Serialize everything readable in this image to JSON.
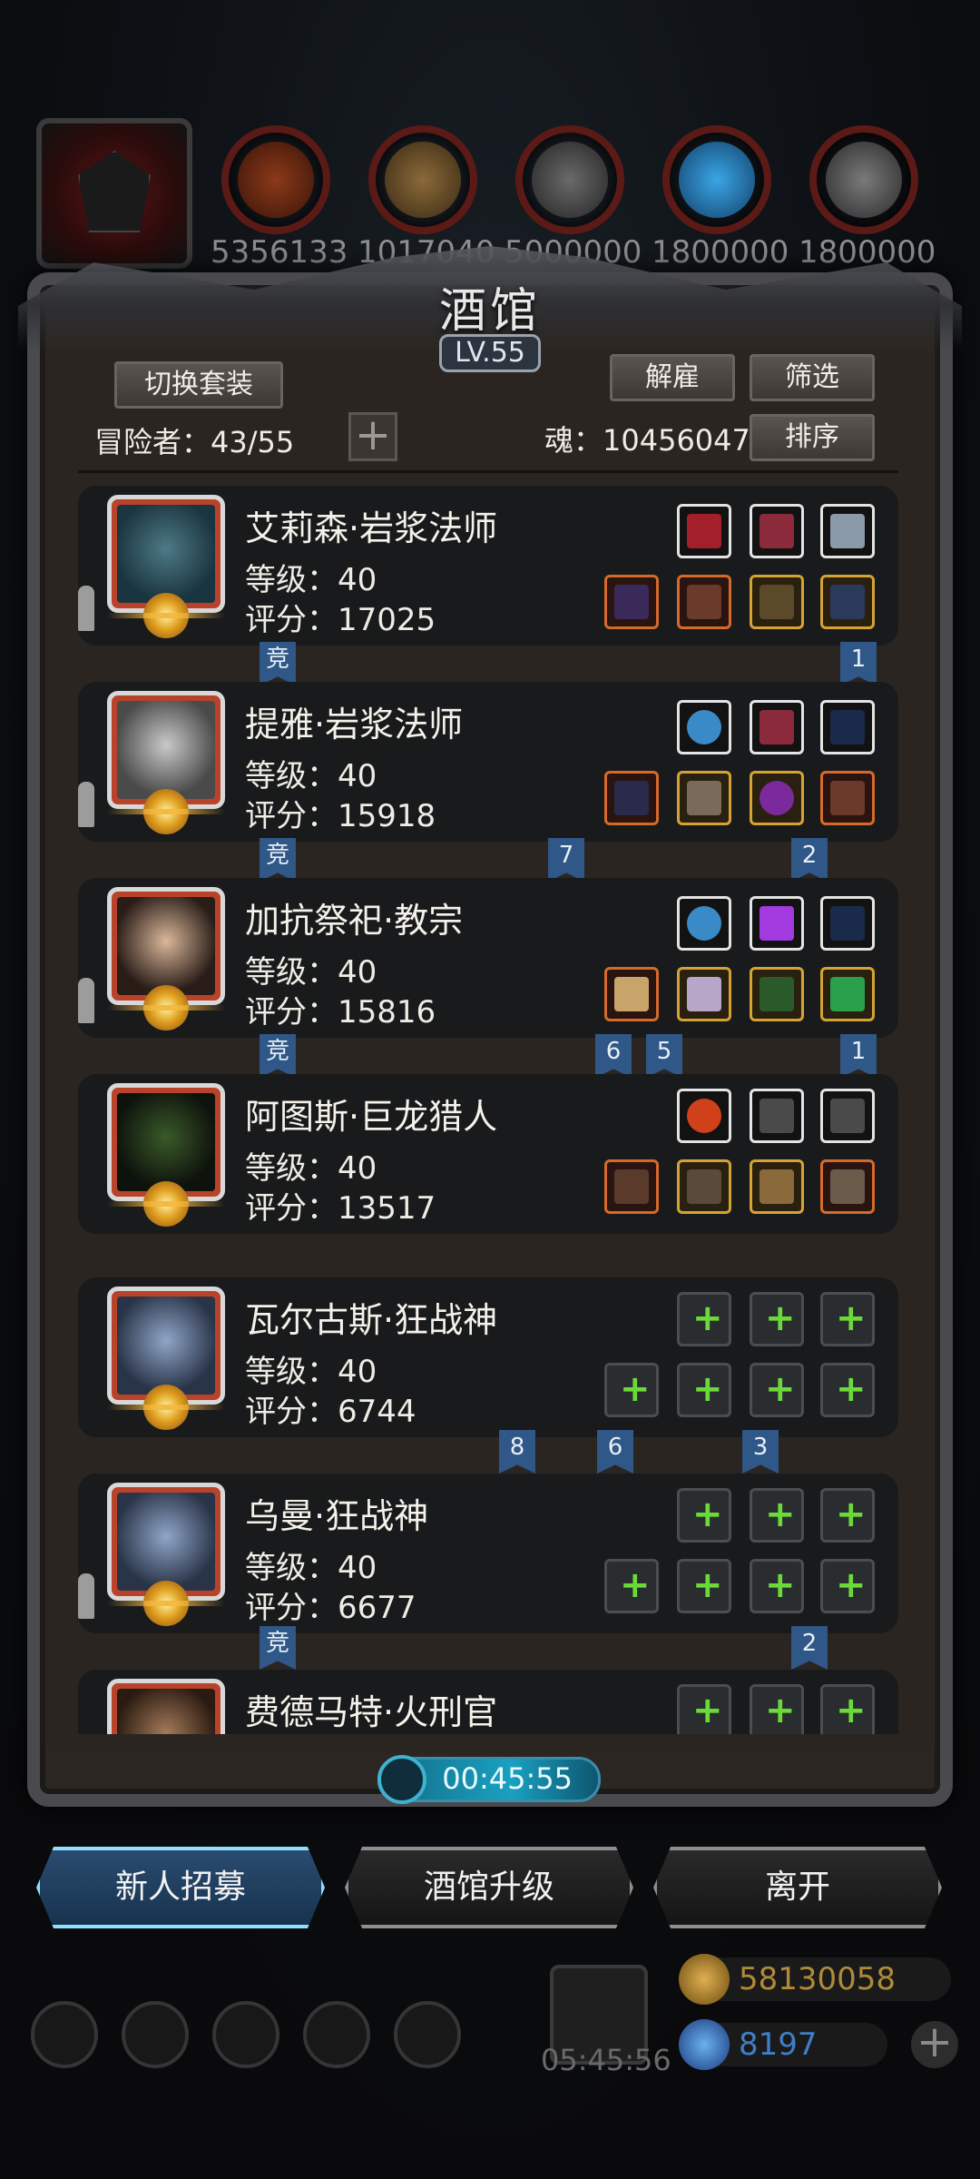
{
  "resources": {
    "portrait_icon": "demon-mask-icon",
    "items": [
      {
        "icon": "meat-icon",
        "value": "5356133"
      },
      {
        "icon": "wood-icon",
        "value": "1017040"
      },
      {
        "icon": "stone-icon",
        "value": "5000000"
      },
      {
        "icon": "crystal-icon",
        "value": "1800000"
      },
      {
        "icon": "iron-icon",
        "value": "1800000"
      }
    ]
  },
  "tavern": {
    "title": "酒馆",
    "level": "LV.55",
    "switch_outfit": "切换套装",
    "dismiss": "解雇",
    "filter": "筛选",
    "sort": "排序",
    "adventurers_label": "冒险者：43/55",
    "soul_label": "魂：10456047",
    "add_symbol": "+"
  },
  "heroes": [
    {
      "name": "艾莉森·岩浆法师",
      "level": "等级：40",
      "score": "评分：17025",
      "tags": [
        {
          "text": "竞"
        },
        {
          "text": "1"
        }
      ]
    },
    {
      "name": "提雅·岩浆法师",
      "level": "等级：40",
      "score": "评分：15918",
      "tags": [
        {
          "text": "竞"
        },
        {
          "text": "7"
        },
        {
          "text": "2"
        }
      ]
    },
    {
      "name": "加抗祭祀·教宗",
      "level": "等级：40",
      "score": "评分：15816",
      "tags": [
        {
          "text": "竞"
        },
        {
          "text": "6"
        },
        {
          "text": "5"
        },
        {
          "text": "1"
        }
      ]
    },
    {
      "name": "阿图斯·巨龙猎人",
      "level": "等级：40",
      "score": "评分：13517",
      "tags": []
    },
    {
      "name": "瓦尔古斯·狂战神",
      "level": "等级：40",
      "score": "评分：6744",
      "tags": [
        {
          "text": "8"
        },
        {
          "text": "6"
        },
        {
          "text": "3"
        }
      ]
    },
    {
      "name": "乌曼·狂战神",
      "level": "等级：40",
      "score": "评分：6677",
      "tags": [
        {
          "text": "竞"
        },
        {
          "text": "2"
        }
      ]
    },
    {
      "name": "费德马特·火刑官",
      "level": "",
      "score": "",
      "tags": []
    }
  ],
  "timer": "00:45:55",
  "bottom_buttons": {
    "recruit": "新人招募",
    "upgrade": "酒馆升级",
    "leave": "离开"
  },
  "hud": {
    "gift_timer": "05:45:56",
    "gold": "58130058",
    "gems": "8197",
    "gold_color": "#c89a3a",
    "gem_color": "#3b7fd6"
  }
}
